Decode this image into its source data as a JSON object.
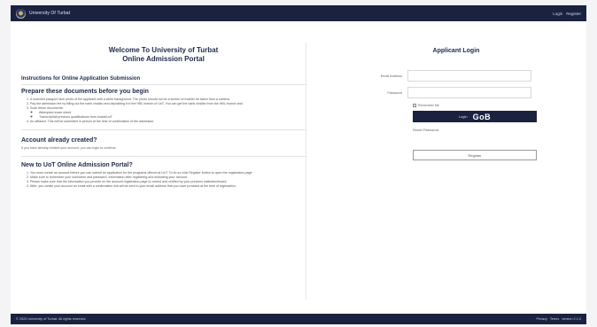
{
  "header": {
    "brand": "University Of Turbat",
    "links": [
      "Login",
      "Register"
    ]
  },
  "welcome": {
    "line1": "Welcome To University of Turbat",
    "line2": "Online Admission Portal"
  },
  "instructions": {
    "title": "Instructions for Online Application Submission",
    "prepare_title": "Prepare these documents before you begin",
    "items": [
      "A scanned passport size photo of the applicant with a white background. The photo should not be a screen of mobile/ be taken from a camera.",
      "Pay the admission fee by filling out the bank challan and depositing it in the HBL branch of UoT. You can get the bank challan from the HBL branch and",
      "Scan these documents:",
      "An affidavit. This will be submitted in person at the time of confirmation of the admission."
    ],
    "sub_items": [
      "Attempted exam sheet",
      "Transcript/all previous qualifications from board/UoT"
    ]
  },
  "account": {
    "title": "Account already created?",
    "text": "If you have already created your account, you can login to continue."
  },
  "new_user": {
    "title": "New to UoT Online Admission Portal?",
    "items": [
      "You must create an account before you can submit an application for the programs offered at UoT. To do so click Register button to open the registration page.",
      "Make sure to remember your username and password. Information after registering and activating your account.",
      "Please make sure that the information you provide on the account registration page is correct and verified by your previous institution/board.",
      "After, you create your account an email with a confirmation link will be sent to your email address that you have provided at the time of registration."
    ]
  },
  "login": {
    "title": "Applicant Login",
    "email_label": "Email Address",
    "email_placeholder": "",
    "password_label": "Password",
    "password_placeholder": "",
    "remember_label": "Remember Me",
    "login_label": "Login",
    "go_text": "GoB",
    "reset_label": "Reset Password",
    "register_label": "Register"
  },
  "footer": {
    "copyright": "© 2023 University of Turbat. All rights reserved.",
    "links": [
      "Privacy",
      "Terms",
      "version 2.1.0"
    ]
  },
  "colors": {
    "navbar": "#1a2240",
    "accent_button": "#1a2240",
    "page_bg": "#f4f4f6"
  }
}
